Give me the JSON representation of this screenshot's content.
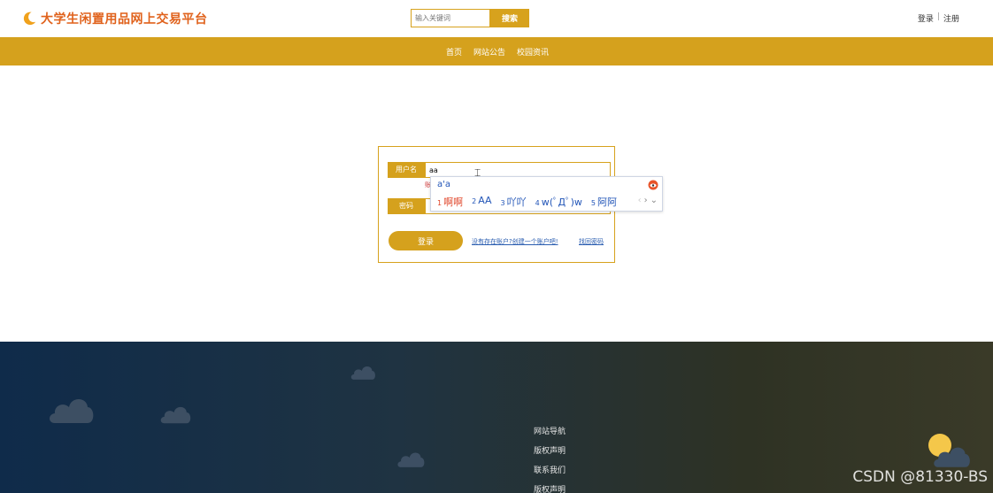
{
  "header": {
    "site_title": "大学生闲置用品网上交易平台",
    "logo_icon": "moon-icon",
    "search": {
      "placeholder": "输入关键词",
      "button_label": "搜索"
    },
    "login_link": "登录",
    "separator": "|",
    "register_link": "注册"
  },
  "nav": {
    "items": [
      "首页",
      "网站公告",
      "校园资讯"
    ]
  },
  "login_form": {
    "username_label": "用户名",
    "username_value": "aa",
    "hint_text": "账",
    "password_label": "密码",
    "password_value": "",
    "login_button": "登录",
    "register_link": "没有存在账户?创建一个账户吧!",
    "forgot_link": "找回密码"
  },
  "ime_popup": {
    "composition": "a'a",
    "candidates": [
      {
        "num": "1",
        "text": "啊啊"
      },
      {
        "num": "2",
        "text": "AA"
      },
      {
        "num": "3",
        "text": "吖吖"
      },
      {
        "num": "4",
        "text": "w(ﾟДﾟ)w"
      },
      {
        "num": "5",
        "text": "阿阿"
      }
    ],
    "prev_icon": "chevron-left-icon",
    "next_icon": "chevron-right-icon",
    "expand_icon": "chevron-down-icon",
    "prev_glyph": "‹",
    "next_glyph": "›",
    "expand_glyph": "⌄"
  },
  "footer": {
    "links": [
      "网站导航",
      "版权声明",
      "联系我们",
      "版权声明"
    ],
    "watermark": "CSDN @81330-BS"
  },
  "colors": {
    "accent": "#d5a11d",
    "title_orange": "#e0621c",
    "link_blue": "#2a5db0",
    "footer_dark": "#0f2b4a"
  }
}
